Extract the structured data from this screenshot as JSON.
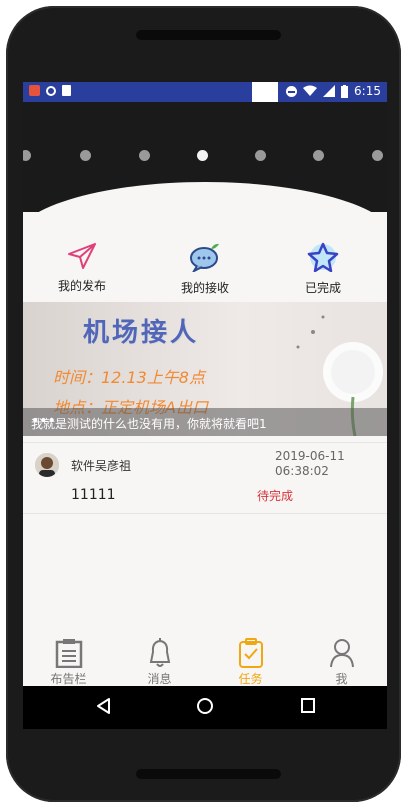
{
  "statusbar": {
    "time": "6:15",
    "icons": [
      "app-notification-icon",
      "circle-icon",
      "sd-card-icon",
      "dnd-icon",
      "wifi-icon",
      "signal-icon",
      "battery-icon"
    ]
  },
  "banner": {
    "dots_count": 7,
    "active_dot": 3
  },
  "quick_actions": [
    {
      "label": "我的发布",
      "icon": "paper-plane-icon"
    },
    {
      "label": "我的接收",
      "icon": "chat-bubble-icon"
    },
    {
      "label": "已完成",
      "icon": "star-icon"
    }
  ],
  "poster": {
    "title": "机场接人",
    "time_line": "时间：12.13上午8点",
    "place_line": "地点：正定机场A出口",
    "caption": "我就是测试的什么也没有用，你就将就看吧1",
    "more": "•••"
  },
  "task": {
    "user": "软件吴彦祖",
    "date": "2019-06-11",
    "time": "06:38:02",
    "title": "11111",
    "status": "待完成"
  },
  "tabs": [
    {
      "label": "布告栏",
      "icon": "notice-board-icon",
      "active": false
    },
    {
      "label": "消息",
      "icon": "bell-icon",
      "active": false
    },
    {
      "label": "任务",
      "icon": "clipboard-check-icon",
      "active": true
    },
    {
      "label": "我",
      "icon": "person-icon",
      "active": false
    }
  ],
  "colors": {
    "statusbar": "#2a3f9d",
    "active_tab": "#f0a812",
    "status_pending": "#d9343a",
    "banner": "#1a1a1a"
  }
}
